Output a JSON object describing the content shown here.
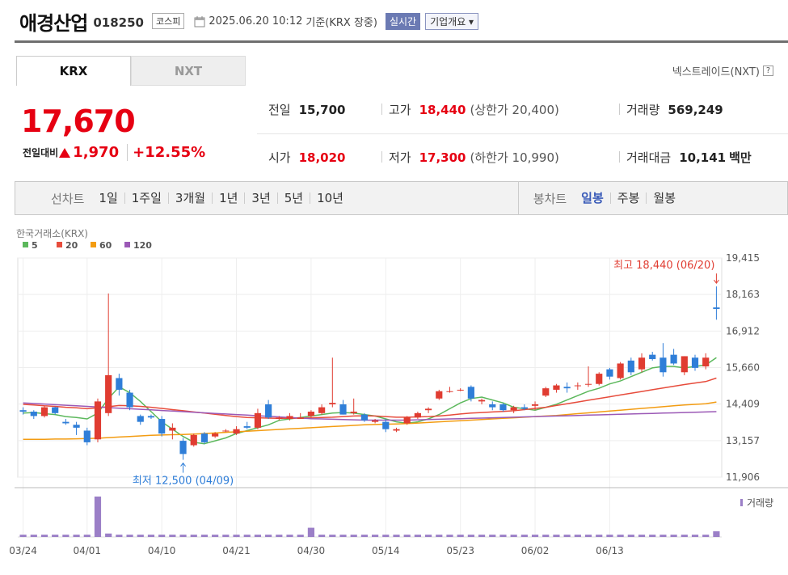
{
  "header": {
    "company": "애경산업",
    "code": "018250",
    "market": "코스피",
    "datetime": "2025.06.20 10:12",
    "basis": "기준(KRX 장중)",
    "realtime_button": "실시간",
    "company_info_button": "기업개요 ▾"
  },
  "tabs": [
    {
      "label": "KRX",
      "active": true
    },
    {
      "label": "NXT",
      "active": false
    }
  ],
  "nextrade_link": "넥스트레이드(NXT)",
  "quote": {
    "price": "17,670",
    "change_label": "전일대비",
    "change_value": "1,970",
    "change_pct": "+12.55%",
    "up_color": "#e60012"
  },
  "stats": {
    "prev_close": {
      "label": "전일",
      "value": "15,700"
    },
    "open": {
      "label": "시가",
      "value": "18,020"
    },
    "high": {
      "label": "고가",
      "value": "18,440",
      "sub": "(상한가 20,400)"
    },
    "low": {
      "label": "저가",
      "value": "17,300",
      "sub": "(하한가 10,990)"
    },
    "volume": {
      "label": "거래량",
      "value": "569,249"
    },
    "amount": {
      "label": "거래대금",
      "value": "10,141",
      "unit": "백만"
    }
  },
  "period_bar": {
    "line_label": "선차트",
    "line_options": [
      "1일",
      "1주일",
      "3개월",
      "1년",
      "3년",
      "5년",
      "10년"
    ],
    "candle_label": "봉차트",
    "candle_options": [
      "일봉",
      "주봉",
      "월봉"
    ],
    "selected_candle": "일봉"
  },
  "chart_data": {
    "type": "candlestick",
    "source_label": "한국거래소(KRX)",
    "legend": [
      {
        "name": "5",
        "color": "#5cb85c"
      },
      {
        "name": "20",
        "color": "#e74c3c"
      },
      {
        "name": "60",
        "color": "#f39c12"
      },
      {
        "name": "120",
        "color": "#9b59b6"
      }
    ],
    "y_ticks": [
      "19,415",
      "18,163",
      "16,912",
      "15,660",
      "14,409",
      "13,157",
      "11,906"
    ],
    "ylim": [
      11906,
      19415
    ],
    "x_labels": [
      "03/24",
      "04/01",
      "04/10",
      "04/21",
      "04/30",
      "05/14",
      "05/23",
      "06/02",
      "06/13"
    ],
    "x_label_index": [
      0,
      6,
      13,
      20,
      27,
      34,
      41,
      48,
      55
    ],
    "high_annotation": "최고 18,440 (06/20)",
    "low_annotation": "최저 12,500 (04/09)",
    "volume_label": "거래량",
    "up_color": "#e03c31",
    "down_color": "#2f7ed8",
    "volume_color": "#9b7fc7",
    "candles": [
      [
        14200,
        14300,
        14050,
        14150
      ],
      [
        14150,
        14200,
        13900,
        14000
      ],
      [
        14000,
        14350,
        13950,
        14300
      ],
      [
        14300,
        14320,
        14050,
        14100
      ],
      [
        13800,
        13900,
        13700,
        13750
      ],
      [
        13700,
        13800,
        13350,
        13600
      ],
      [
        13500,
        13600,
        13000,
        13100
      ],
      [
        13200,
        14600,
        13100,
        14500
      ],
      [
        14100,
        18200,
        14000,
        15400
      ],
      [
        15300,
        15450,
        14700,
        14900
      ],
      [
        14800,
        14900,
        14200,
        14300
      ],
      [
        14000,
        14050,
        13700,
        13800
      ],
      [
        14000,
        14050,
        13900,
        13950
      ],
      [
        13900,
        14000,
        13300,
        13400
      ],
      [
        13500,
        13750,
        13200,
        13600
      ],
      [
        13150,
        13250,
        12500,
        12700
      ],
      [
        13000,
        13400,
        12950,
        13350
      ],
      [
        13400,
        13450,
        13050,
        13100
      ],
      [
        13300,
        13450,
        13250,
        13400
      ],
      [
        13500,
        13550,
        13450,
        13500
      ],
      [
        13400,
        13650,
        13350,
        13550
      ],
      [
        13650,
        13800,
        13550,
        13600
      ],
      [
        13600,
        14250,
        13550,
        14100
      ],
      [
        14400,
        14550,
        13900,
        13950
      ],
      [
        13900,
        14000,
        13850,
        13950
      ],
      [
        13900,
        14100,
        13850,
        14000
      ],
      [
        13900,
        14100,
        13900,
        13950
      ],
      [
        14000,
        14200,
        13950,
        14150
      ],
      [
        14100,
        14400,
        14050,
        14300
      ],
      [
        14400,
        16000,
        14300,
        14450
      ],
      [
        14400,
        14550,
        14050,
        14050
      ],
      [
        14100,
        14600,
        14050,
        14150
      ],
      [
        14050,
        14100,
        13800,
        13850
      ],
      [
        13800,
        13900,
        13750,
        13850
      ],
      [
        13800,
        13900,
        13450,
        13550
      ],
      [
        13500,
        13600,
        13450,
        13550
      ],
      [
        13750,
        14000,
        13700,
        13950
      ],
      [
        13950,
        14150,
        13900,
        14100
      ],
      [
        14200,
        14300,
        14100,
        14250
      ],
      [
        14600,
        14900,
        14550,
        14850
      ],
      [
        14850,
        15000,
        14800,
        14850
      ],
      [
        14900,
        14950,
        14850,
        14900
      ],
      [
        15000,
        15050,
        14500,
        14600
      ],
      [
        14500,
        14600,
        14400,
        14550
      ],
      [
        14400,
        14500,
        14200,
        14300
      ],
      [
        14400,
        14450,
        14150,
        14200
      ],
      [
        14200,
        14350,
        14100,
        14300
      ],
      [
        14300,
        14400,
        14200,
        14250
      ],
      [
        14350,
        14500,
        14200,
        14400
      ],
      [
        14700,
        15000,
        14650,
        14950
      ],
      [
        14900,
        15100,
        14800,
        15050
      ],
      [
        15000,
        15150,
        14800,
        14950
      ],
      [
        15050,
        15150,
        14900,
        15050
      ],
      [
        15100,
        15700,
        15000,
        15100
      ],
      [
        15100,
        15500,
        15050,
        15450
      ],
      [
        15600,
        15650,
        15250,
        15350
      ],
      [
        15300,
        15850,
        15250,
        15800
      ],
      [
        15900,
        16000,
        15400,
        15500
      ],
      [
        15600,
        16150,
        15500,
        16000
      ],
      [
        16100,
        16200,
        15900,
        15950
      ],
      [
        16000,
        16500,
        15350,
        15500
      ],
      [
        16100,
        16300,
        15750,
        15800
      ],
      [
        15500,
        16050,
        15400,
        16050
      ],
      [
        16000,
        16100,
        15550,
        15650
      ],
      [
        15700,
        16150,
        15600,
        16000
      ],
      [
        17720,
        18440,
        17300,
        17670
      ]
    ],
    "volumes": [
      2,
      2,
      2,
      2,
      2,
      2,
      2,
      35,
      3,
      2,
      2,
      2,
      2,
      2,
      2,
      2,
      2,
      2,
      2,
      2,
      2,
      2,
      2,
      2,
      2,
      2,
      2,
      8,
      2,
      2,
      2,
      2,
      2,
      2,
      2,
      2,
      2,
      2,
      2,
      2,
      2,
      2,
      2,
      2,
      2,
      2,
      2,
      2,
      2,
      2,
      2,
      2,
      2,
      2,
      2,
      2,
      2,
      2,
      2,
      2,
      2,
      2,
      2,
      2,
      2,
      5
    ],
    "ma": {
      "5": [
        14100,
        14120,
        14080,
        14050,
        13980,
        13950,
        13900,
        14100,
        14600,
        15000,
        14800,
        14500,
        14150,
        13800,
        13550,
        13300,
        13100,
        13050,
        13150,
        13250,
        13400,
        13500,
        13600,
        13700,
        13850,
        13900,
        13950,
        14000,
        14050,
        14100,
        14120,
        14100,
        14050,
        14000,
        13900,
        13800,
        13750,
        13800,
        13900,
        14050,
        14250,
        14450,
        14600,
        14650,
        14550,
        14450,
        14300,
        14250,
        14200,
        14300,
        14400,
        14550,
        14700,
        14850,
        14950,
        15100,
        15200,
        15350,
        15500,
        15650,
        15700,
        15700,
        15650,
        15700,
        15750,
        16000
      ],
      "20": [
        14400,
        14380,
        14350,
        14330,
        14300,
        14280,
        14250,
        14280,
        14320,
        14360,
        14350,
        14330,
        14300,
        14260,
        14220,
        14180,
        14140,
        14100,
        14060,
        14020,
        13980,
        13950,
        13940,
        13930,
        13920,
        13920,
        13930,
        13940,
        13950,
        13960,
        13980,
        14000,
        14010,
        14000,
        13980,
        13960,
        13960,
        13970,
        13980,
        14000,
        14030,
        14070,
        14100,
        14120,
        14140,
        14160,
        14180,
        14220,
        14260,
        14300,
        14360,
        14420,
        14480,
        14540,
        14600,
        14660,
        14720,
        14780,
        14840,
        14900,
        14960,
        15020,
        15080,
        15130,
        15180,
        15300
      ],
      "60": [
        13200,
        13200,
        13200,
        13210,
        13210,
        13220,
        13230,
        13240,
        13260,
        13280,
        13300,
        13320,
        13340,
        13350,
        13360,
        13370,
        13380,
        13400,
        13420,
        13440,
        13460,
        13480,
        13500,
        13520,
        13540,
        13560,
        13580,
        13600,
        13620,
        13640,
        13660,
        13680,
        13700,
        13710,
        13720,
        13730,
        13740,
        13760,
        13780,
        13800,
        13820,
        13840,
        13860,
        13880,
        13900,
        13920,
        13940,
        13960,
        13980,
        14000,
        14020,
        14050,
        14080,
        14110,
        14140,
        14170,
        14200,
        14230,
        14260,
        14290,
        14320,
        14350,
        14380,
        14400,
        14420,
        14480
      ],
      "120": [
        14450,
        14430,
        14410,
        14390,
        14370,
        14350,
        14330,
        14310,
        14290,
        14270,
        14250,
        14230,
        14210,
        14190,
        14170,
        14150,
        14130,
        14110,
        14090,
        14070,
        14050,
        14030,
        14010,
        13990,
        13970,
        13950,
        13930,
        13910,
        13900,
        13890,
        13880,
        13870,
        13860,
        13860,
        13860,
        13860,
        13860,
        13870,
        13880,
        13890,
        13900,
        13910,
        13920,
        13930,
        13940,
        13950,
        13960,
        13970,
        13980,
        13990,
        14000,
        14010,
        14020,
        14030,
        14040,
        14050,
        14060,
        14070,
        14080,
        14090,
        14100,
        14110,
        14120,
        14130,
        14140,
        14150
      ]
    }
  }
}
